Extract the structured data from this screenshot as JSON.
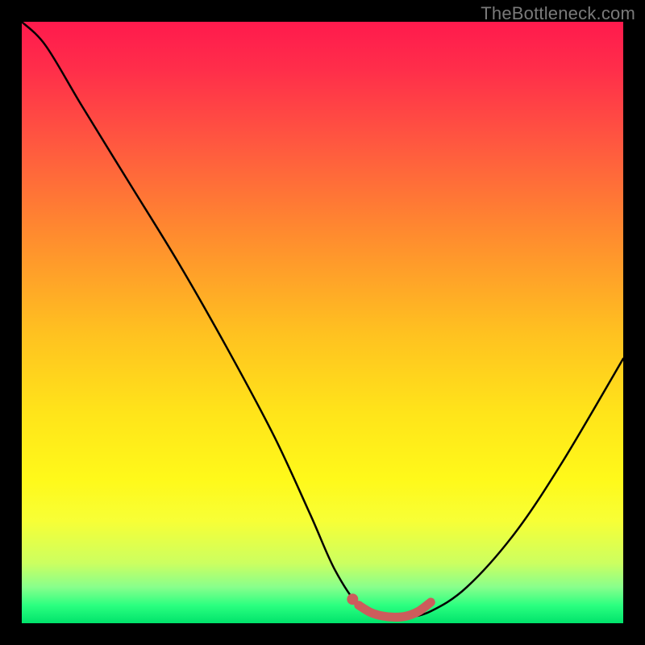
{
  "watermark": "TheBottleneck.com",
  "chart_data": {
    "type": "line",
    "title": "",
    "xlabel": "",
    "ylabel": "",
    "xlim": [
      0,
      100
    ],
    "ylim": [
      0,
      100
    ],
    "series": [
      {
        "name": "bottleneck-curve",
        "x": [
          0,
          4,
          10,
          18,
          26,
          34,
          42,
          48,
          52,
          56,
          60,
          64,
          68,
          74,
          82,
          90,
          100
        ],
        "y": [
          100,
          96,
          86,
          73,
          60,
          46,
          31,
          18,
          9,
          3,
          1,
          1,
          2,
          6,
          15,
          27,
          44
        ],
        "color": "#000000"
      },
      {
        "name": "highlight-segment",
        "x": [
          56,
          58,
          60,
          62,
          64,
          66,
          68
        ],
        "y": [
          3.0,
          1.8,
          1.2,
          1.0,
          1.2,
          2.0,
          3.5
        ],
        "color": "#cc5c5c"
      }
    ],
    "markers": [
      {
        "name": "highlight-dot",
        "x": 55,
        "y": 4,
        "color": "#cc5c5c"
      }
    ],
    "background_gradient": {
      "top": "#ff1a4d",
      "mid": "#ffe41a",
      "bottom": "#00e36b"
    }
  }
}
